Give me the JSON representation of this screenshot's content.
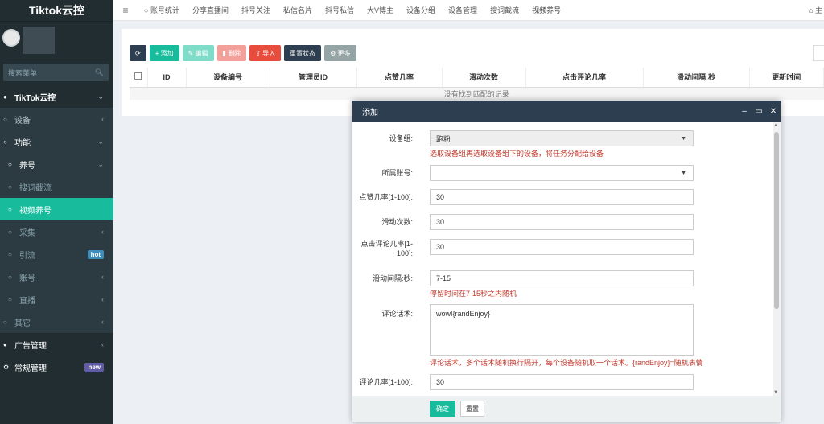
{
  "sidebar": {
    "brand": "Tiktok云控",
    "search_placeholder": "搜索菜单",
    "items": [
      {
        "label": "TikTok云控"
      },
      {
        "label": "设备"
      },
      {
        "label": "功能"
      },
      {
        "label": "养号"
      },
      {
        "label": "搜词截流"
      },
      {
        "label": "视频养号"
      },
      {
        "label": "采集"
      },
      {
        "label": "引流",
        "badge": "hot"
      },
      {
        "label": "账号"
      },
      {
        "label": "直播"
      },
      {
        "label": "其它"
      },
      {
        "label": "广告管理"
      },
      {
        "label": "常规管理",
        "badge": "new"
      }
    ]
  },
  "topbar": {
    "tabs": [
      "账号统计",
      "分享直播间",
      "抖号关注",
      "私信名片",
      "抖号私信",
      "大V博主",
      "设备分组",
      "设备管理",
      "搜词截流",
      "视频养号"
    ],
    "home": "主"
  },
  "toolbar": {
    "add": "添加",
    "edit": "编辑",
    "delete": "删除",
    "import": "导入",
    "reset_status": "重置状态",
    "more": "更多"
  },
  "table": {
    "columns": [
      "ID",
      "设备编号",
      "管理员ID",
      "点赞几率",
      "滑动次数",
      "点击评论几率",
      "滑动间隔:秒",
      "更新时间"
    ],
    "empty_text": "没有找到匹配的记录"
  },
  "modal": {
    "title": "添加",
    "fields": {
      "device_group_label": "设备组:",
      "device_group_value": "跑粉",
      "device_group_hint": "选取设备组再选取设备组下的设备，将任务分配给设备",
      "account_label": "所属账号:",
      "account_value": "",
      "like_rate_label": "点赞几率[1-100]:",
      "like_rate_value": "30",
      "swipe_count_label": "滑动次数:",
      "swipe_count_value": "30",
      "comment_click_label": "点击评论几率[1-100]:",
      "comment_click_value": "30",
      "swipe_interval_label": "滑动间隔:秒:",
      "swipe_interval_value": "7-15",
      "swipe_interval_hint": "停留时间在7-15秒之内随机",
      "comment_text_label": "评论话术:",
      "comment_text_value": "wow!{randEnjoy}",
      "comment_text_hint": "评论话术，多个话术随机换行隔开，每个设备随机取一个话术。{randEnjoy}=随机表情",
      "comment_rate_label": "评论几率[1-100]:",
      "comment_rate_value": "30"
    },
    "ok": "确定",
    "reset": "重置"
  }
}
